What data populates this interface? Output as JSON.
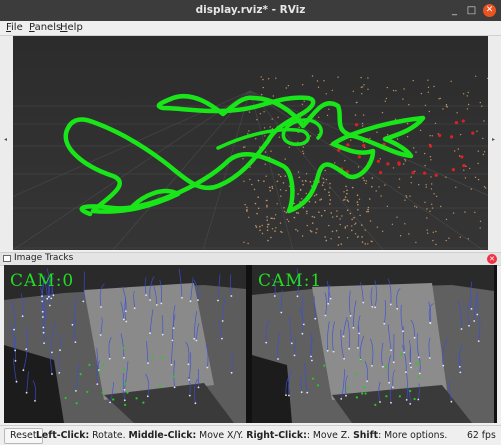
{
  "window": {
    "title": "display.rviz* - RViz",
    "minimize_glyph": "_",
    "maximize_glyph": "□",
    "close_glyph": "✕"
  },
  "menubar": {
    "items": [
      {
        "label": "File"
      },
      {
        "label": "Panels"
      },
      {
        "label": "Help"
      }
    ]
  },
  "viewport": {
    "description_icon": "3d-render-view",
    "trajectory_color": "#19e619",
    "point_cloud_color": "#d9a36a",
    "feature_color": "#e02020"
  },
  "image_tracks": {
    "title": "Image Tracks",
    "cameras": [
      {
        "label": "CAM:0"
      },
      {
        "label": "CAM:1"
      }
    ]
  },
  "status": {
    "reset_label": "Reset",
    "hint_parts": [
      {
        "text": "Left-Click:",
        "bold": true
      },
      {
        "text": " Rotate. ",
        "bold": false
      },
      {
        "text": "Middle-Click:",
        "bold": true
      },
      {
        "text": " Move X/Y. ",
        "bold": false
      },
      {
        "text": "Right-Click:",
        "bold": true
      },
      {
        "text": ": Move Z. ",
        "bold": false
      },
      {
        "text": "Shift",
        "bold": true
      },
      {
        "text": ": More options.",
        "bold": false
      }
    ],
    "fps": "62 fps"
  }
}
